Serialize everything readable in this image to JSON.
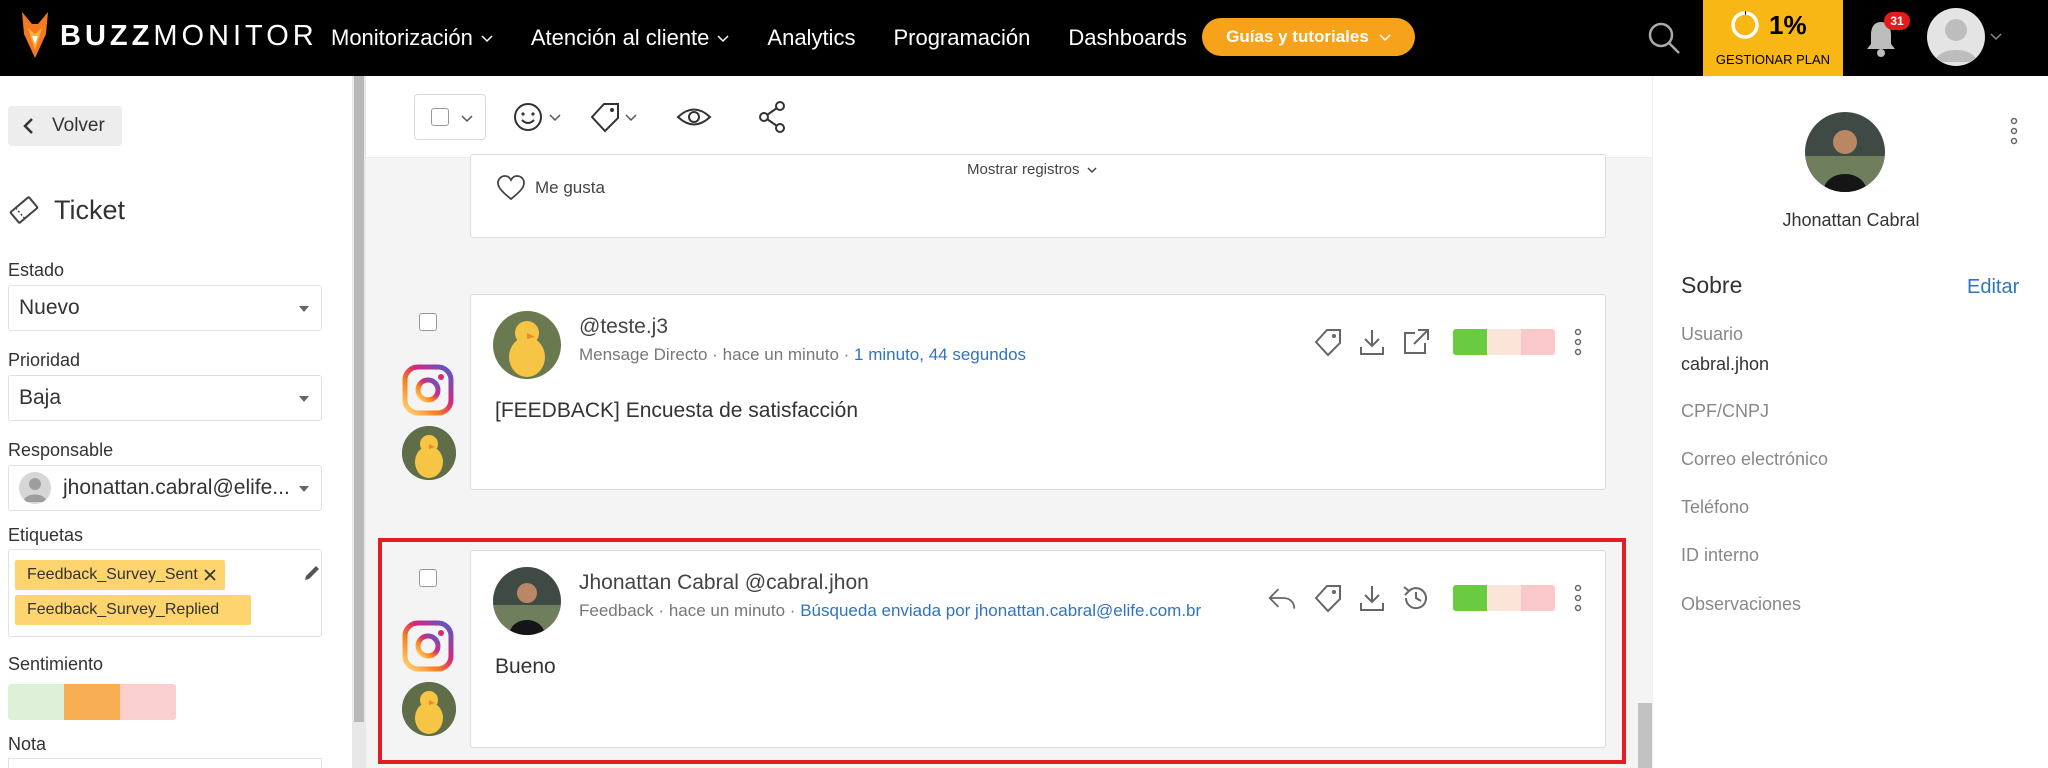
{
  "brand": {
    "name_bold": "BUZZ",
    "name_light": "MONITOR"
  },
  "nav": {
    "items": [
      {
        "label": "Monitorización",
        "dropdown": true
      },
      {
        "label": "Atención al cliente",
        "dropdown": true
      },
      {
        "label": "Analytics",
        "dropdown": false
      },
      {
        "label": "Programación",
        "dropdown": false
      },
      {
        "label": "Dashboards",
        "dropdown": false
      }
    ],
    "guides_label": "Guías y tutoriales",
    "plan_percent": "1%",
    "plan_label": "GESTIONAR PLAN",
    "notifications_count": "31",
    "icons": [
      "search-icon",
      "bell-icon",
      "user-avatar"
    ]
  },
  "left_panel": {
    "back_label": "Volver",
    "title": "Ticket",
    "estado_label": "Estado",
    "estado_value": "Nuevo",
    "prioridad_label": "Prioridad",
    "prioridad_value": "Baja",
    "responsable_label": "Responsable",
    "responsable_value": "jhonattan.cabral@elife...",
    "etiquetas_label": "Etiquetas",
    "tags": [
      "Feedback_Survey_Sent",
      "Feedback_Survey_Replied"
    ],
    "sentimiento_label": "Sentimiento",
    "sentiment_colors": [
      "#dff0d8",
      "#f7ad52",
      "#f9cfcf"
    ],
    "nota_label": "Nota"
  },
  "toolbar": {
    "icons": [
      "checkbox-icon",
      "emoji-icon",
      "tag-icon",
      "eye-icon",
      "share-icon"
    ]
  },
  "feed": {
    "previous_post": {
      "show_records_label": "Mostrar registros",
      "like_label": "Me gusta"
    },
    "posts": [
      {
        "name": "@teste.j3",
        "type": "Mensage Directo",
        "time": "hace un minuto",
        "extra": "1 minuto, 44 segundos",
        "text": "[FEEDBACK] Encuesta de satisfacción",
        "sentiment_colors": [
          "#6acb43",
          "#fbe5d8",
          "#f9c9c9"
        ]
      },
      {
        "name": "Jhonattan Cabral @cabral.jhon",
        "type": "Feedback",
        "time": "hace un minuto",
        "extra": "Búsqueda enviada por jhonattan.cabral@elife.com.br",
        "text": "Bueno",
        "sentiment_colors": [
          "#6acb43",
          "#fbe5d8",
          "#f9c9c9"
        ]
      }
    ],
    "separator": "·"
  },
  "right_panel": {
    "profile_name": "Jhonattan Cabral",
    "sobre_label": "Sobre",
    "edit_label": "Editar",
    "usuario_label": "Usuario",
    "usuario_value": "cabral.jhon",
    "fields": [
      "CPF/CNPJ",
      "Correo electrónico",
      "Teléfono",
      "ID interno",
      "Observaciones"
    ]
  },
  "colors": {
    "accent": "#f7a21b",
    "plan": "#f9b716",
    "link": "#2f74c0",
    "highlight": "#e31d24"
  }
}
